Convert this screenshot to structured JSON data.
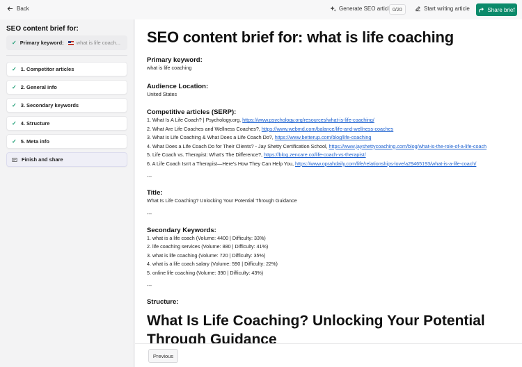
{
  "topbar": {
    "back_label": "Back",
    "generate_label": "Generate SEO article",
    "generate_count": "0/20",
    "write_label": "Start writing article",
    "share_label": "Share brief",
    "accent": "#0b8a6a"
  },
  "sidebar": {
    "title": "SEO content brief for:",
    "keyword_label": "Primary keyword:",
    "keyword_value": "what is life coach...",
    "steps": [
      {
        "label": "1. Competitor articles"
      },
      {
        "label": "2. General info"
      },
      {
        "label": "3. Secondary keywords"
      },
      {
        "label": "4. Structure"
      },
      {
        "label": "5. Meta info"
      },
      {
        "label": "Finish and share"
      }
    ]
  },
  "doc": {
    "title": "SEO content brief for: what is life coaching",
    "primary_keyword_heading": "Primary keyword:",
    "primary_keyword": "what is life coaching",
    "audience_heading": "Audience Location:",
    "audience": "United States",
    "competitors_heading": "Competitive articles (SERP):",
    "competitors": [
      {
        "text": "1. What Is A Life Coach? | Psychology.org, ",
        "url": "https://www.psychology.org/resources/what-is-life-coaching/"
      },
      {
        "text": "2. What Are Life Coaches and Wellness Coaches?, ",
        "url": "https://www.webmd.com/balance/life-and-wellness-coaches"
      },
      {
        "text": "3. What is Life Coaching & What Does a Life Coach Do?, ",
        "url": "https://www.betterup.com/blog/life-coaching"
      },
      {
        "text": "4. What Does a Life Coach Do for Their Clients? - Jay Shetty Certification School, ",
        "url": "https://www.jayshettycoaching.com/blog/what-is-the-role-of-a-life-coach"
      },
      {
        "text": "5. Life Coach vs. Therapist: What's The Difference?, ",
        "url": "https://blog.zencare.co/life-coach-vs-therapist/"
      },
      {
        "text": "6. A Life Coach Isn't a Therapist—Here's How They Can Help You, ",
        "url": "https://www.oprahdaily.com/life/relationships-love/a29465193/what-is-a-life-coach/"
      }
    ],
    "separator": "---",
    "title_heading": "Title:",
    "article_title": "What Is Life Coaching? Unlocking Your Potential Through Guidance",
    "secondary_heading": "Secondary Keywords:",
    "secondary_keywords": [
      "1. what is a life coach (Volume: 4400 | Difficulty: 33%)",
      "2. life coaching services (Volume: 880 | Difficulty: 41%)",
      "3. what is life coaching (Volume: 720 | Difficulty: 35%)",
      "4. what is a life coach salary (Volume: 590 | Difficulty: 22%)",
      "5. online life coaching (Volume: 390 | Difficulty: 43%)"
    ],
    "structure_heading": "Structure:",
    "structure_h1": "What Is Life Coaching? Unlocking Your Potential Through Guidance"
  },
  "footer": {
    "previous_label": "Previous"
  }
}
